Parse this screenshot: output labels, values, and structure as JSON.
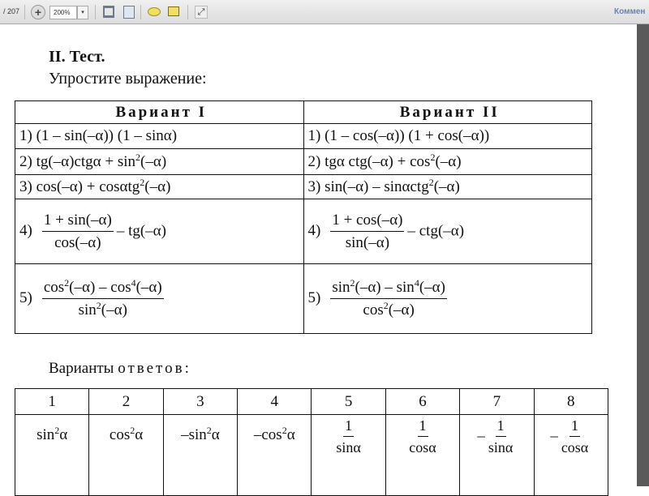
{
  "toolbar": {
    "page_total": "/ 207",
    "zoom": "200%",
    "comments_label": "Коммен"
  },
  "doc": {
    "heading": "II. Тест.",
    "instruction": "Упростите выражение:",
    "variant1": "Вариант I",
    "variant2": "Вариант II",
    "rows": [
      {
        "left": "1) (1 – sin(–α)) (1 – sinα)",
        "right": "1) (1 – cos(–α)) (1 + cos(–α))"
      },
      {
        "left_pre": "2) tg(–α)ctgα + sin",
        "left_sup": "2",
        "left_post": "(–α)",
        "right_pre": "2) tgα ctg(–α) + cos",
        "right_sup": "2",
        "right_post": "(–α)"
      },
      {
        "left_pre": "3) cos(–α) + cosαtg",
        "left_sup": "2",
        "left_post": "(–α)",
        "right_pre": "3) sin(–α) – sinαctg",
        "right_sup": "2",
        "right_post": "(–α)"
      },
      {
        "left_label": "4)",
        "left_num": "1 + sin(–α)",
        "left_den": "cos(–α)",
        "left_tail": "– tg(–α)",
        "right_label": "4)",
        "right_num": "1 + cos(–α)",
        "right_den": "sin(–α)",
        "right_tail": "– ctg(–α)"
      },
      {
        "left_label": "5)",
        "left_num_a": "cos",
        "left_num_sup_a": "2",
        "left_num_b": "(–α) – cos",
        "left_num_sup_b": "4",
        "left_num_c": "(–α)",
        "left_den_a": "sin",
        "left_den_sup": "2",
        "left_den_b": "(–α)",
        "right_label": "5)",
        "right_num_a": "sin",
        "right_num_sup_a": "2",
        "right_num_b": "(–α) – sin",
        "right_num_sup_b": "4",
        "right_num_c": "(–α)",
        "right_den_a": "cos",
        "right_den_sup": "2",
        "right_den_b": "(–α)"
      }
    ],
    "answers_title_a": "Варианты ",
    "answers_title_b": "ответов:",
    "answers": {
      "headers": [
        "1",
        "2",
        "3",
        "4",
        "5",
        "6",
        "7",
        "8"
      ],
      "a1": {
        "pre": "sin",
        "sup": "2",
        "post": "α"
      },
      "a2": {
        "pre": "cos",
        "sup": "2",
        "post": "α"
      },
      "a3": {
        "pre": "–sin",
        "sup": "2",
        "post": "α"
      },
      "a4": {
        "pre": "–cos",
        "sup": "2",
        "post": "α"
      },
      "a5": {
        "num": "1",
        "den": "sinα"
      },
      "a6": {
        "num": "1",
        "den": "cosα"
      },
      "a7": {
        "sign": "–",
        "num": "1",
        "den": "sinα"
      },
      "a8": {
        "sign": "–",
        "num": "1",
        "den": "cosα"
      }
    }
  }
}
